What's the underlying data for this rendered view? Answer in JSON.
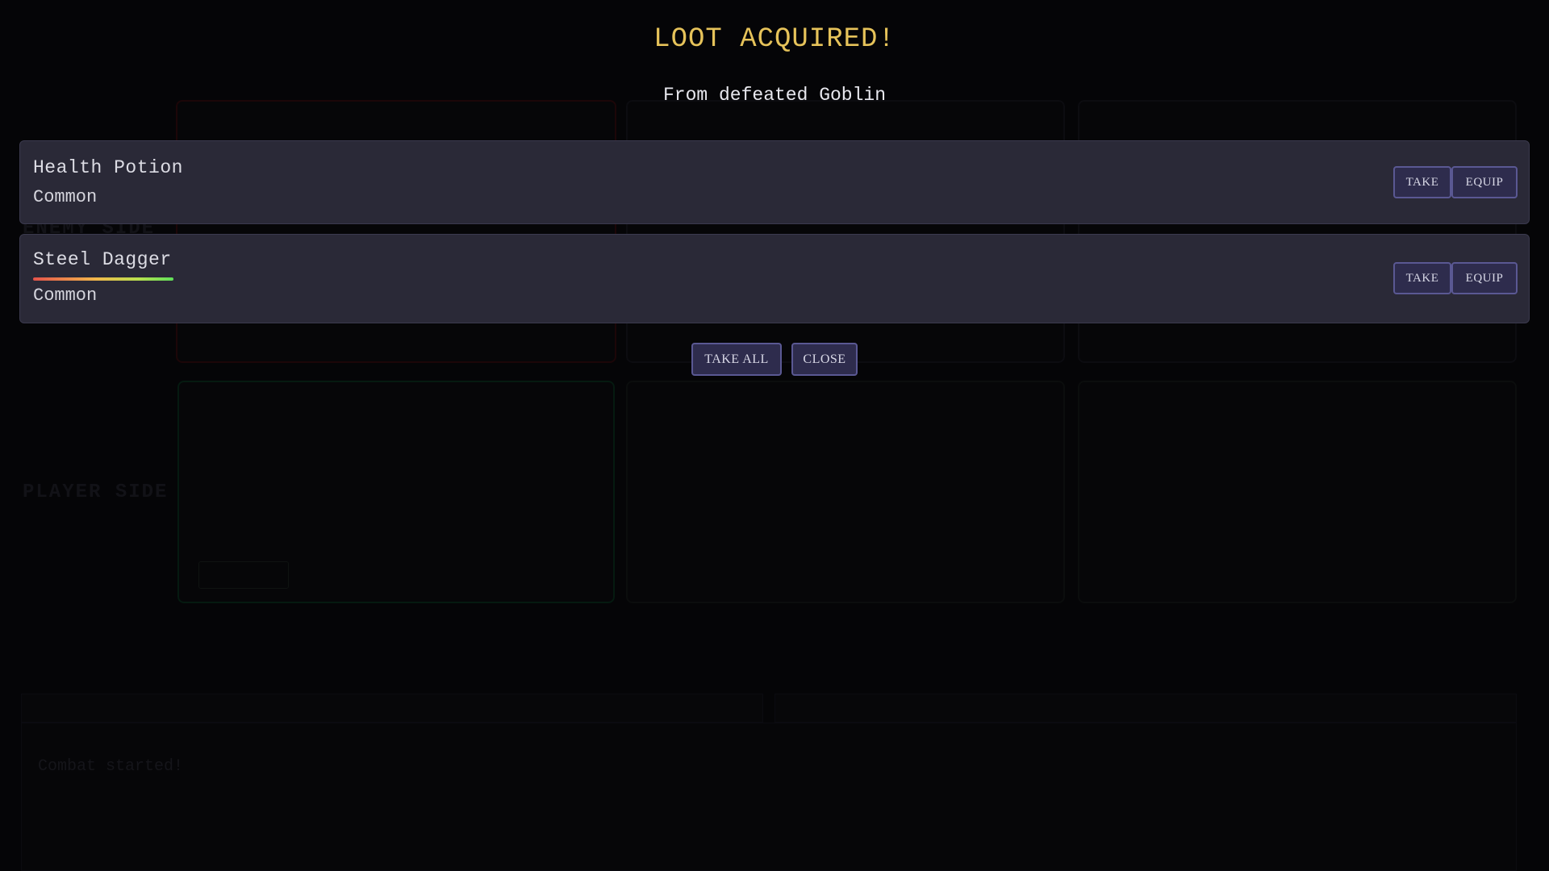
{
  "background": {
    "enemy_side_label": "ENEMY SIDE",
    "player_side_label": "PLAYER SIDE",
    "enemy_card_name": "",
    "player_card_name": "",
    "log_tabs": [
      "",
      ""
    ],
    "combat_log_line": "Combat started!"
  },
  "loot": {
    "title": "LOOT ACQUIRED!",
    "subtitle": "From defeated Goblin",
    "items": [
      {
        "name": "Health Potion",
        "rarity": "Common",
        "take_label": "TAKE",
        "equip_label": "EQUIP"
      },
      {
        "name": "Steel Dagger",
        "rarity": "Common",
        "durability": 1.0,
        "take_label": "TAKE",
        "equip_label": "EQUIP"
      }
    ],
    "take_all_label": "TAKE ALL",
    "close_label": "CLOSE"
  },
  "colors": {
    "title": "#e6c35a",
    "item_bg": "#2a2937",
    "button_bg": "#2e2c4d",
    "button_border": "#5a5893",
    "page_bg": "#050507"
  }
}
